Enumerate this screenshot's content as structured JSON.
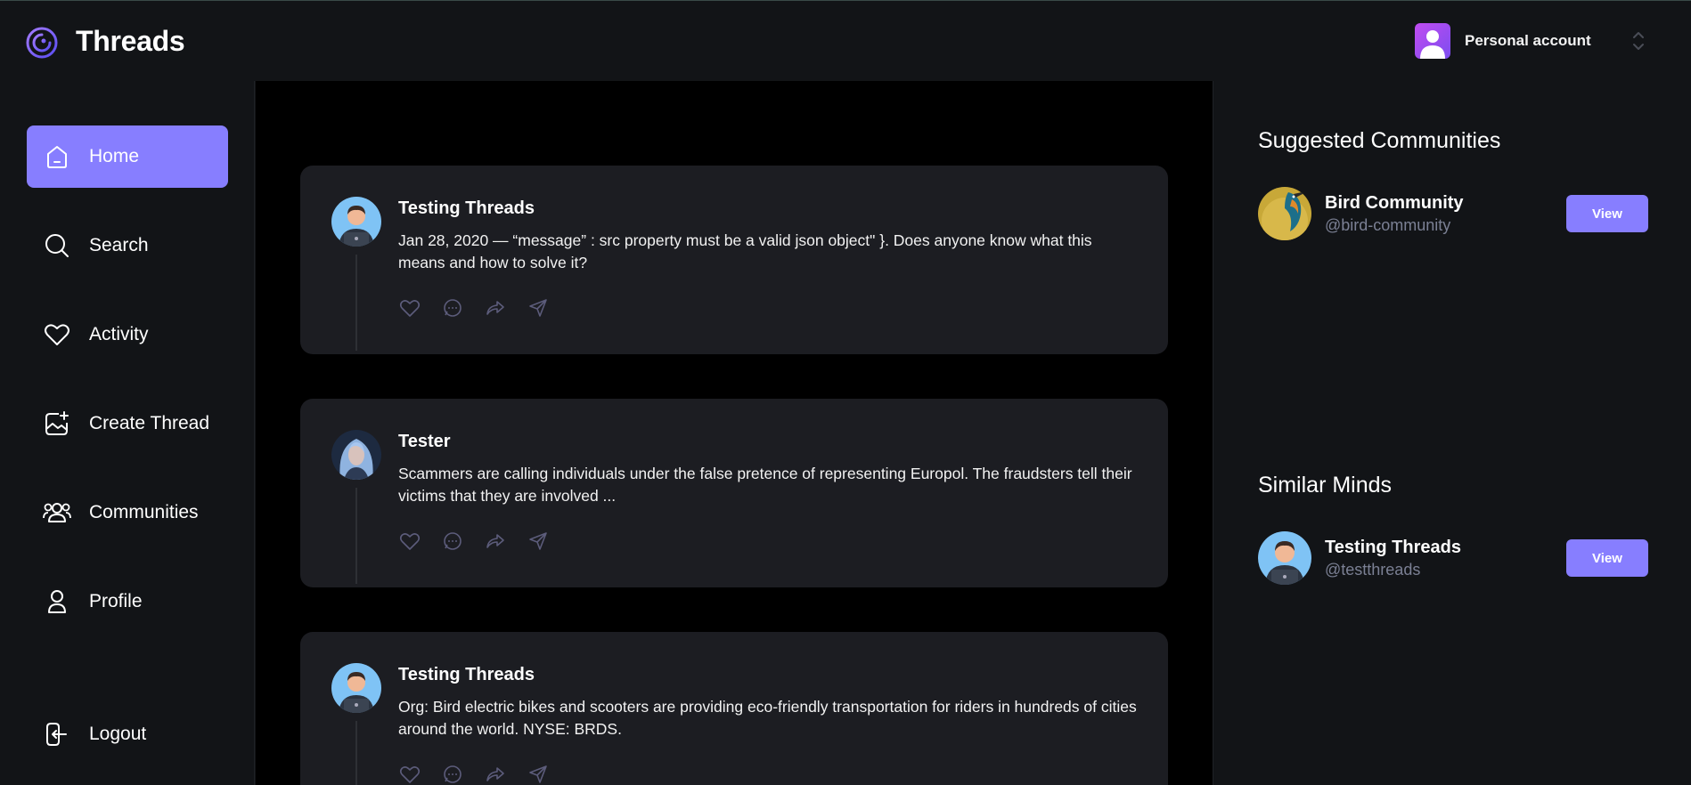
{
  "app": {
    "brand": "Threads",
    "account_label": "Personal account"
  },
  "sidebar": {
    "items": [
      {
        "label": "Home",
        "icon": "home-icon",
        "active": true
      },
      {
        "label": "Search",
        "icon": "search-icon",
        "active": false
      },
      {
        "label": "Activity",
        "icon": "heart-icon",
        "active": false
      },
      {
        "label": "Create Thread",
        "icon": "image-plus-icon",
        "active": false
      },
      {
        "label": "Communities",
        "icon": "users-icon",
        "active": false
      },
      {
        "label": "Profile",
        "icon": "user-icon",
        "active": false
      }
    ],
    "logout_label": "Logout"
  },
  "feed": {
    "threads": [
      {
        "author": "Testing Threads",
        "text": "Jan 28, 2020 — “message” : src property must be a valid json object\" }. Does anyone know what this means and how to solve it?"
      },
      {
        "author": "Tester",
        "text": "Scammers are calling individuals under the false pretence of representing Europol. The fraudsters tell their victims that they are involved ..."
      },
      {
        "author": "Testing Threads",
        "text": "Org: Bird electric bikes and scooters are providing eco-friendly transportation for riders in hundreds of cities around the world. NYSE: BRDS."
      }
    ]
  },
  "rightbar": {
    "communities_title": "Suggested Communities",
    "communities": [
      {
        "name": "Bird Community",
        "handle": "@bird-community",
        "button": "View"
      }
    ],
    "users_title": "Similar Minds",
    "users": [
      {
        "name": "Testing Threads",
        "handle": "@testthreads",
        "button": "View"
      }
    ]
  },
  "colors": {
    "accent": "#877eff",
    "background": "#121417",
    "card": "#1c1d22",
    "feed": "#000000",
    "muted": "#7b8094"
  }
}
